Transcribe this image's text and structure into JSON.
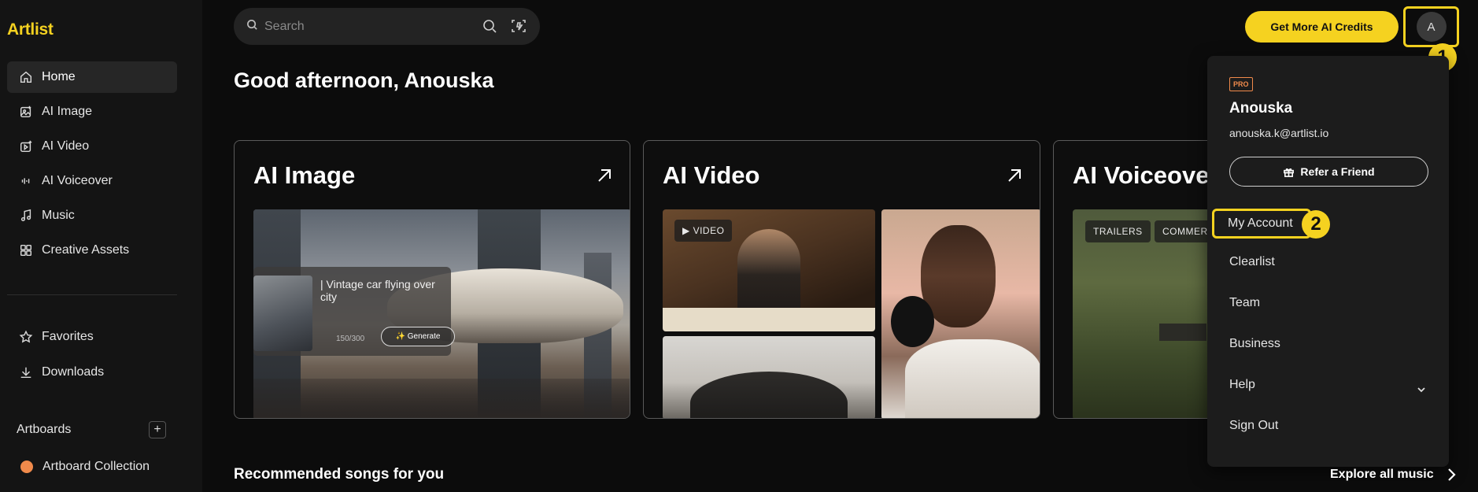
{
  "app": {
    "logo": "Artlist"
  },
  "sidebar": {
    "items": [
      {
        "label": "Home",
        "icon": "home-icon",
        "active": true
      },
      {
        "label": "AI Image",
        "icon": "ai-image-icon"
      },
      {
        "label": "AI Video",
        "icon": "ai-video-icon"
      },
      {
        "label": "AI Voiceover",
        "icon": "voiceover-icon"
      },
      {
        "label": "Music",
        "icon": "music-icon"
      },
      {
        "label": "Creative Assets",
        "icon": "grid-icon"
      }
    ],
    "secondary": [
      {
        "label": "Favorites",
        "icon": "star-icon"
      },
      {
        "label": "Downloads",
        "icon": "download-icon"
      }
    ],
    "artboards": {
      "label": "Artboards",
      "add": "+"
    },
    "artboard_items": [
      {
        "label": "Artboard Collection",
        "color": "#f08a4b"
      }
    ]
  },
  "search": {
    "placeholder": "Search"
  },
  "header": {
    "credits_button": "Get More AI Credits",
    "avatar_initial": "A"
  },
  "steps": {
    "one": "1",
    "two": "2"
  },
  "greeting": "Good afternoon, Anouska",
  "cards": {
    "ai_image": {
      "title": "AI Image",
      "prompt": "| Vintage car flying over city",
      "counter": "150/300",
      "generate": "✨ Generate"
    },
    "ai_video": {
      "title": "AI Video",
      "tag": "▶ VIDEO"
    },
    "ai_voiceover": {
      "title": "AI Voiceover",
      "tags": [
        "TRAILERS",
        "COMMERCIALS"
      ]
    }
  },
  "menu": {
    "badge": "PRO",
    "name": "Anouska",
    "email": "anouska.k@artlist.io",
    "refer": "Refer a Friend",
    "items": [
      "My Account",
      "Clearlist",
      "Team",
      "Business",
      "Help",
      "Sign Out"
    ]
  },
  "recommended": {
    "title": "Recommended songs for you",
    "explore": "Explore all music"
  },
  "colors": {
    "accent": "#f5d220",
    "pro": "#f08a4b",
    "background": "#0c0c0c",
    "sidebar": "#141414"
  }
}
